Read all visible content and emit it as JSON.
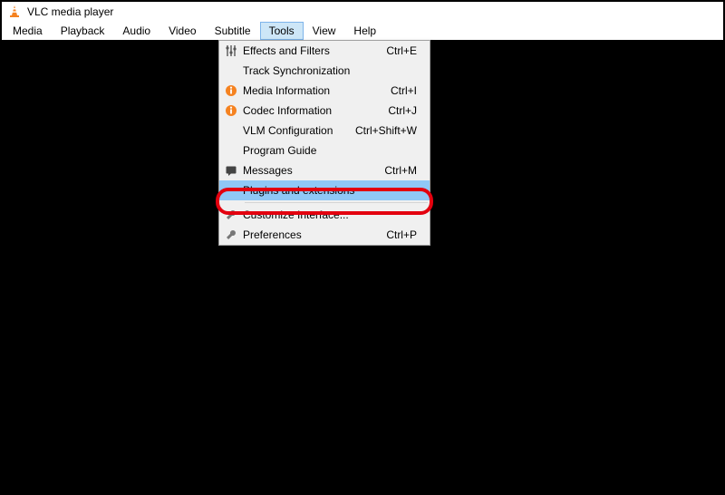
{
  "title": "VLC media player",
  "menubar": [
    {
      "label": "Media"
    },
    {
      "label": "Playback"
    },
    {
      "label": "Audio"
    },
    {
      "label": "Video"
    },
    {
      "label": "Subtitle"
    },
    {
      "label": "Tools",
      "open": true
    },
    {
      "label": "View"
    },
    {
      "label": "Help"
    }
  ],
  "tools_menu": {
    "items": [
      {
        "icon": "sliders",
        "label": "Effects and Filters",
        "shortcut": "Ctrl+E"
      },
      {
        "icon": "",
        "label": "Track Synchronization",
        "shortcut": ""
      },
      {
        "icon": "info",
        "label": "Media Information",
        "shortcut": "Ctrl+I"
      },
      {
        "icon": "info",
        "label": "Codec Information",
        "shortcut": "Ctrl+J"
      },
      {
        "icon": "",
        "label": "VLM Configuration",
        "shortcut": "Ctrl+Shift+W"
      },
      {
        "icon": "",
        "label": "Program Guide",
        "shortcut": ""
      },
      {
        "icon": "messages",
        "label": "Messages",
        "shortcut": "Ctrl+M"
      },
      {
        "icon": "",
        "label": "Plugins and extensions",
        "shortcut": "",
        "highlight": true
      },
      {
        "separator": true
      },
      {
        "icon": "wrench",
        "label": "Customize Interface...",
        "shortcut": ""
      },
      {
        "icon": "wrench",
        "label": "Preferences",
        "shortcut": "Ctrl+P"
      }
    ]
  }
}
